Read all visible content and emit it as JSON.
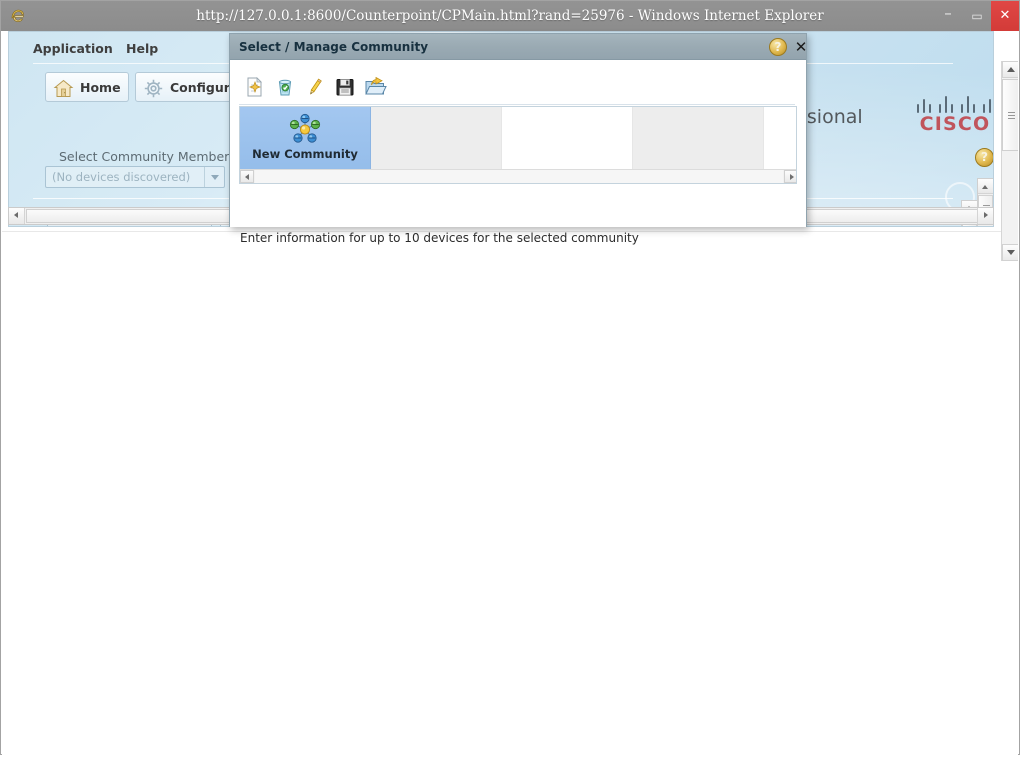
{
  "browser": {
    "title": "http://127.0.0.1:8600/Counterpoint/CPMain.html?rand=25976 - Windows Internet Explorer",
    "app_icon": "internet-explorer-icon",
    "window_controls": {
      "minimize": "–",
      "maximize": "▭",
      "close": "✕"
    }
  },
  "app": {
    "menu": [
      {
        "label": "Application"
      },
      {
        "label": "Help"
      }
    ],
    "toolbar": [
      {
        "label": "Home",
        "icon": "home-icon"
      },
      {
        "label": "Configure",
        "icon": "gear-icon"
      }
    ],
    "community_member": {
      "label": "Select Community Member:",
      "selected_value": "(No devices discovered)",
      "placeholder": "(No devices discovered)"
    },
    "search_field": {
      "value": "",
      "placeholder": ""
    },
    "product_name_visible": "ssional",
    "brand": {
      "wordmark": "CISCO",
      "wordmark_color": "#c0545c",
      "bar_color": "#5a6b78"
    },
    "help_icon": "question-mark-help-icon"
  },
  "dialog": {
    "title": "Select / Manage Community",
    "help_button": "question-mark-help-icon",
    "close_button": "✕",
    "titlebar_color": "#9aaab3",
    "toolbar": [
      {
        "name": "new-community",
        "icon": "new-document-icon",
        "label": "New"
      },
      {
        "name": "delete-community",
        "icon": "trash-bin-icon",
        "label": "Delete"
      },
      {
        "name": "edit-community",
        "icon": "pencil-edit-icon",
        "label": "Edit"
      },
      {
        "name": "save-community",
        "icon": "floppy-disk-save-icon",
        "label": "Save"
      },
      {
        "name": "open-community",
        "icon": "open-folder-icon",
        "label": "Open"
      }
    ],
    "communities": [
      {
        "label": "New Community",
        "icon": "network-community-icon",
        "selected": true,
        "state": "filled"
      },
      {
        "label": "",
        "icon": "",
        "selected": false,
        "state": "empty-gray"
      },
      {
        "label": "",
        "icon": "",
        "selected": false,
        "state": "empty-white"
      },
      {
        "label": "",
        "icon": "",
        "selected": false,
        "state": "empty-gray"
      },
      {
        "label": "",
        "icon": "",
        "selected": false,
        "state": "empty-white"
      }
    ],
    "hint": "Enter information for up to 10 devices for the selected community",
    "selection_color": "#9dc3ee"
  }
}
